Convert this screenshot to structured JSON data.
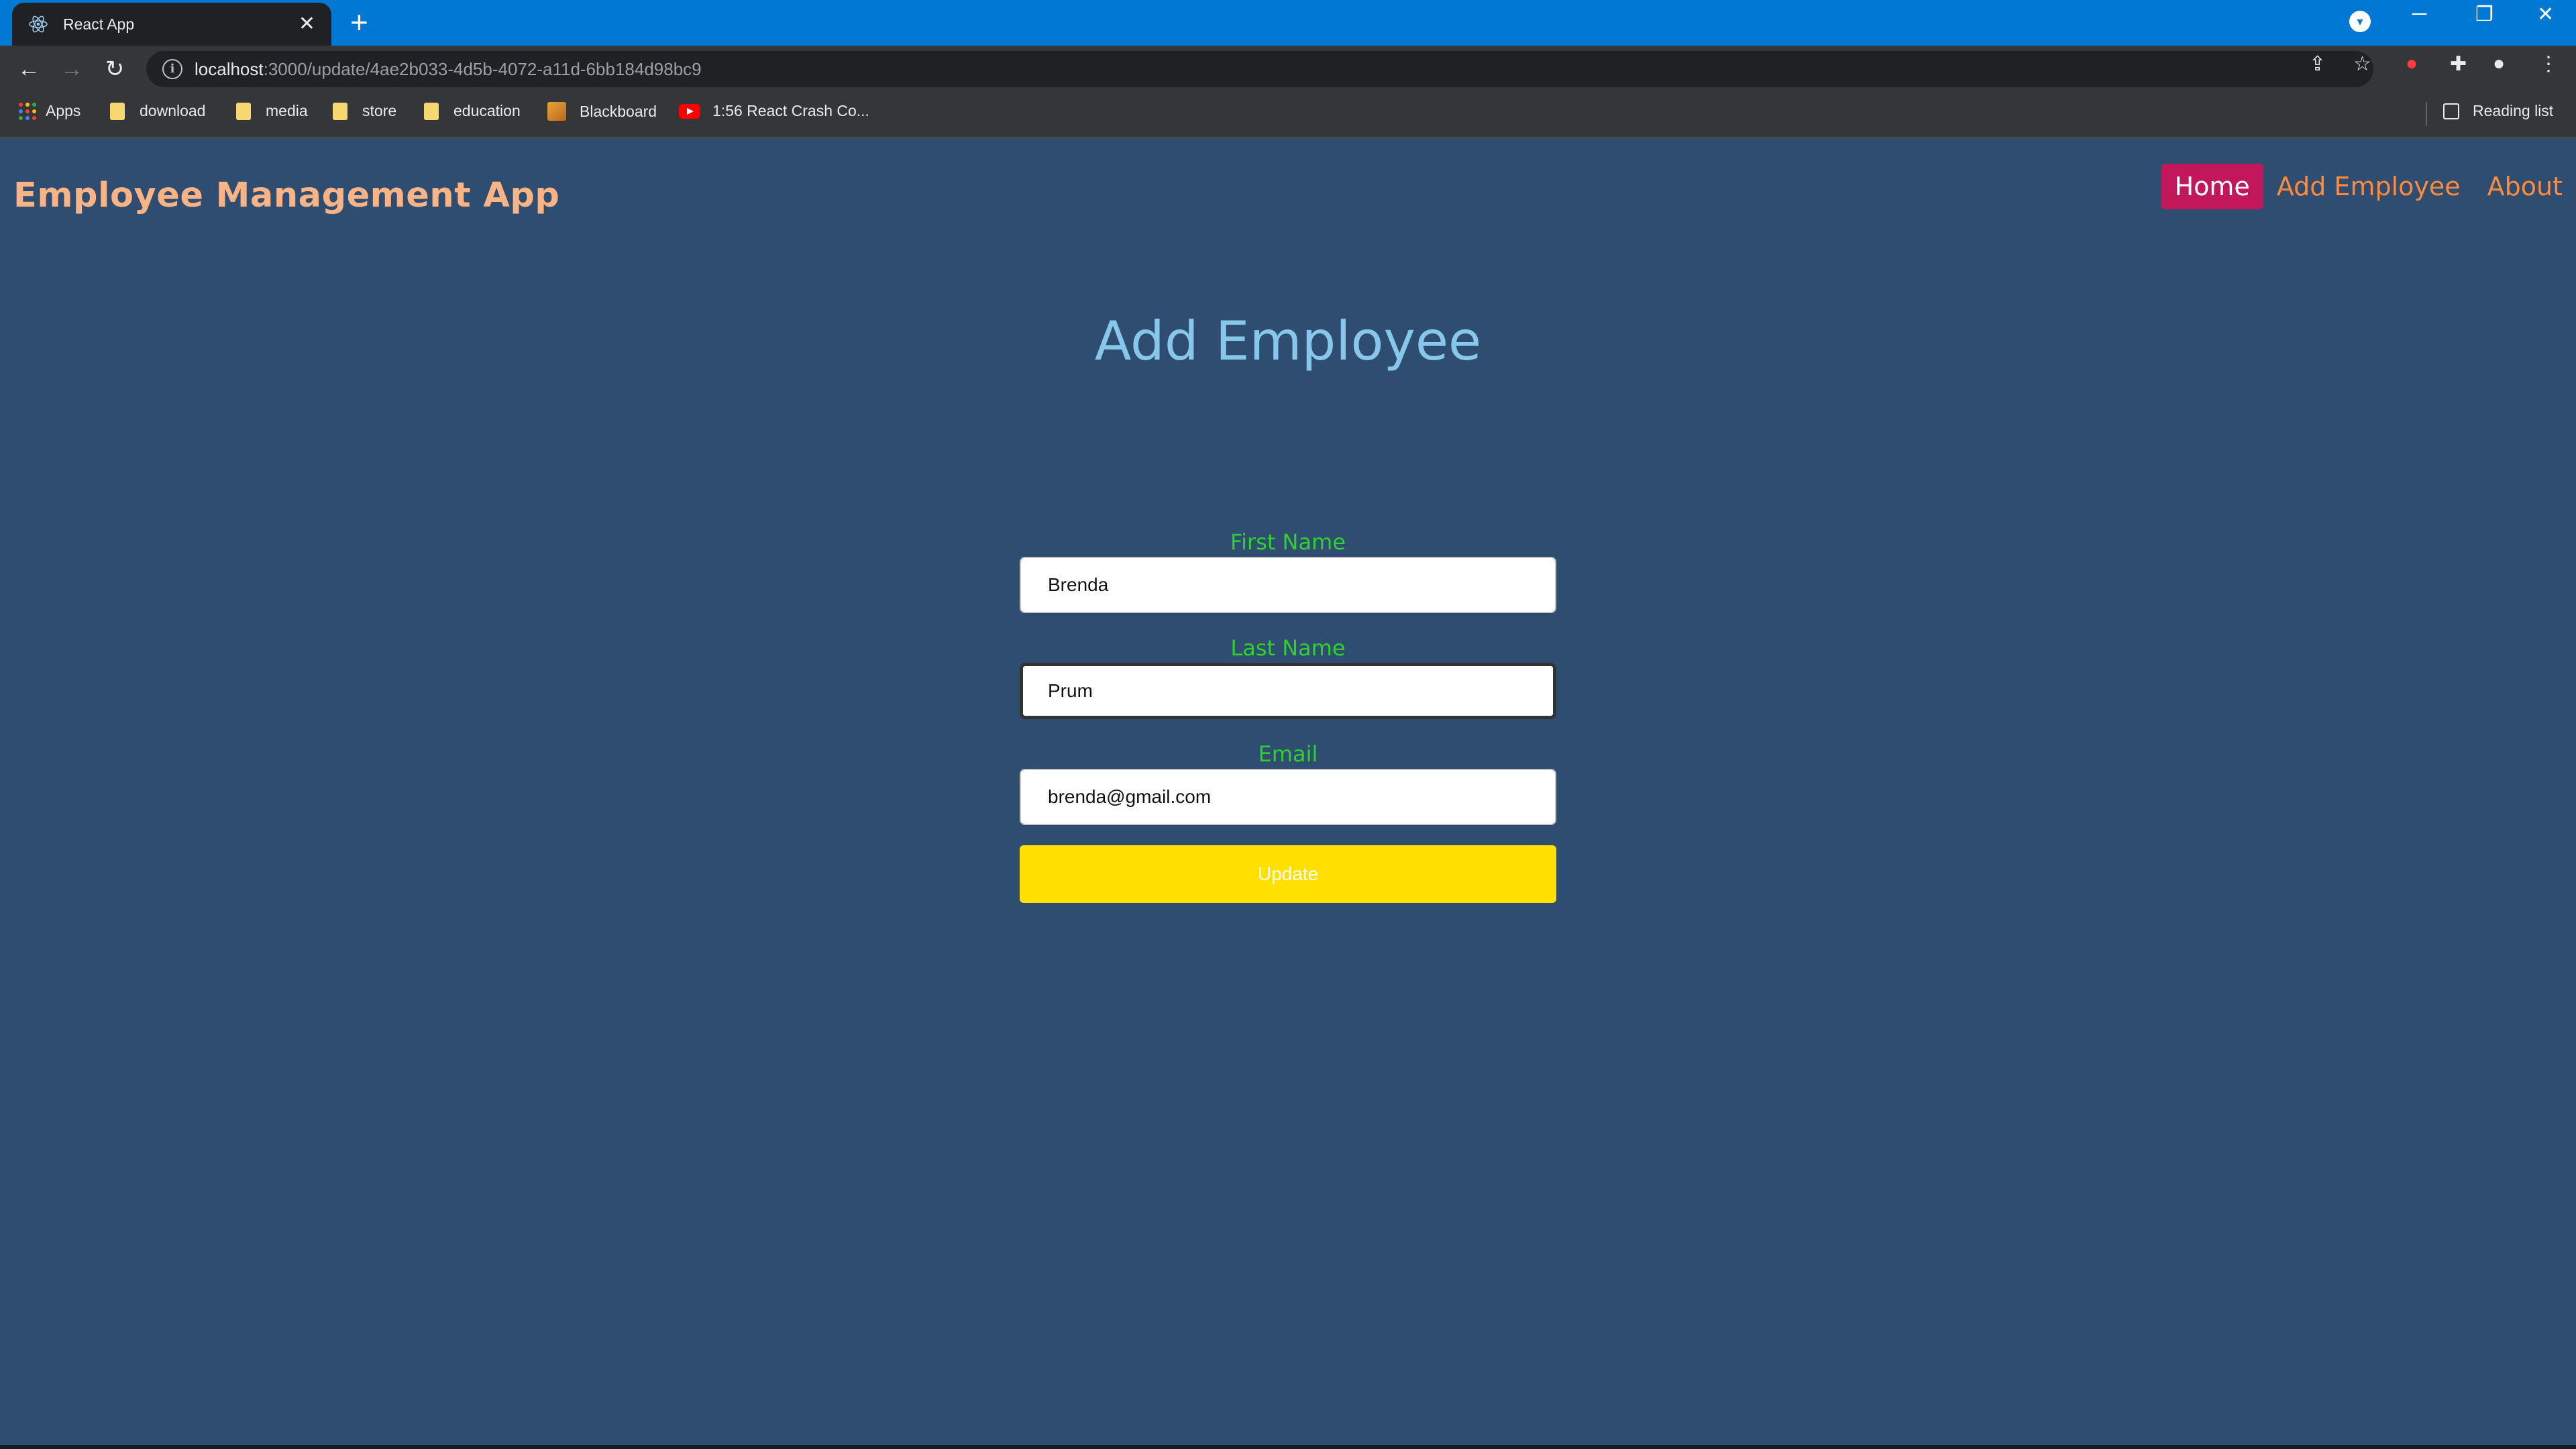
{
  "browser": {
    "tab_title": "React App",
    "tab_close": "✕",
    "new_tab": "+",
    "url_host": "localhost",
    "url_path": ":3000/update/4ae2b033-4d5b-4072-a11d-6bb184d98bc9",
    "bookmarks": [
      {
        "label": "Apps",
        "icon": "apps-grid-icon"
      },
      {
        "label": "download",
        "icon": "folder-icon"
      },
      {
        "label": "media",
        "icon": "folder-icon"
      },
      {
        "label": "store",
        "icon": "folder-icon"
      },
      {
        "label": "education",
        "icon": "folder-icon"
      },
      {
        "label": "Blackboard",
        "icon": "blackboard-icon"
      },
      {
        "label": "1:56 React Crash Co...",
        "icon": "youtube-icon"
      }
    ],
    "reading_list": "Reading list",
    "colors": {
      "tabbar": "#0078d4",
      "toolbar": "#35363a",
      "tab": "#202124"
    }
  },
  "app": {
    "brand": "Employee Management App",
    "nav": [
      {
        "label": "Home",
        "active": true
      },
      {
        "label": "Add Employee",
        "active": false
      },
      {
        "label": "About",
        "active": false
      }
    ],
    "title": "Add Employee",
    "form": {
      "first_name_label": "First Name",
      "first_name_value": "Brenda",
      "last_name_label": "Last Name",
      "last_name_value": "Prum",
      "email_label": "Email",
      "email_value": "brenda@gmail.com",
      "submit_label": "Update"
    },
    "colors": {
      "background": "#2e4d71",
      "brand": "#f9b384",
      "nav_link": "#ff8a3c",
      "nav_active_bg": "#c2185b",
      "title": "#86c7ea",
      "label": "#2fd02f",
      "button": "#ffe000"
    }
  }
}
